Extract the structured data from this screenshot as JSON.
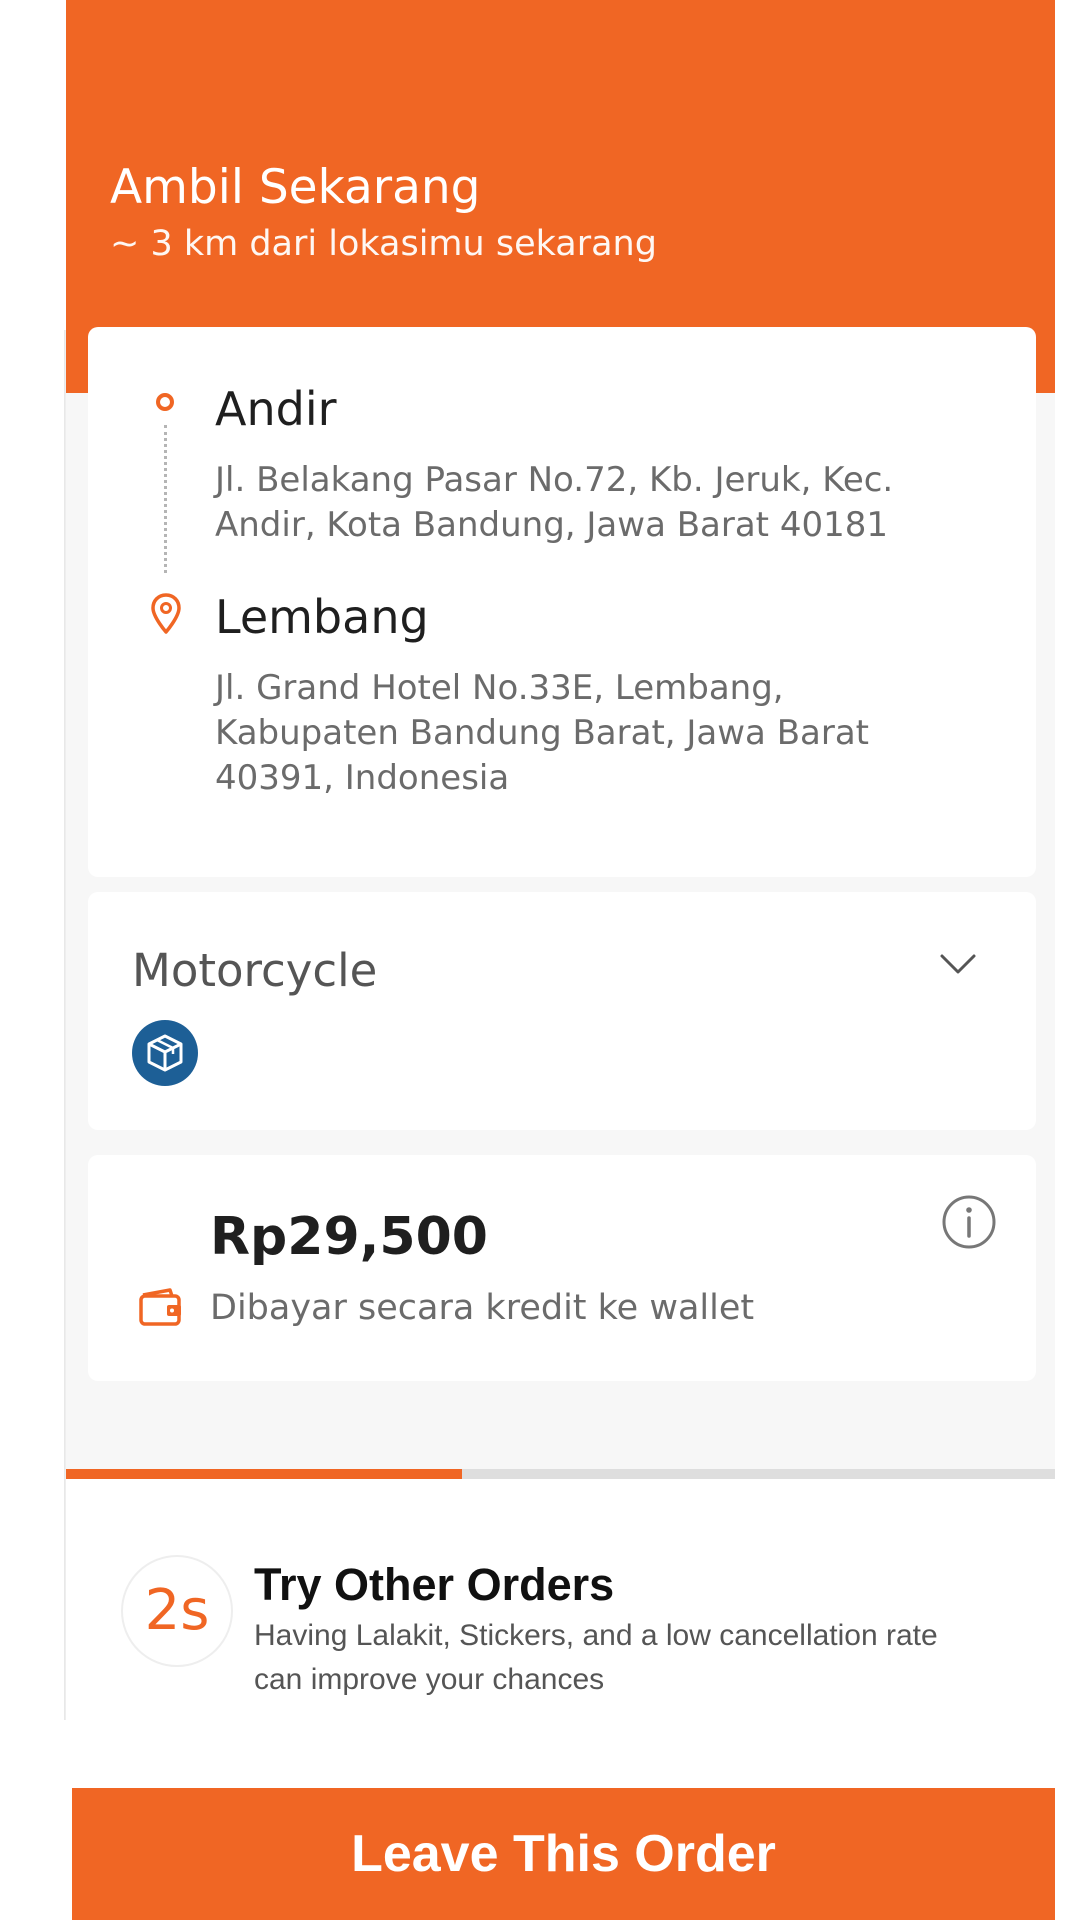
{
  "header": {
    "title": "Ambil Sekarang",
    "subtitle": "~ 3 km dari lokasimu sekarang"
  },
  "route": {
    "origin": {
      "name": "Andir",
      "address": "Jl. Belakang Pasar No.72, Kb. Jeruk, Kec. Andir, Kota Bandung, Jawa Barat 40181"
    },
    "destination": {
      "name": "Lembang",
      "address": "Jl. Grand Hotel No.33E, Lembang, Kabupaten Bandung Barat, Jawa Barat 40391, Indonesia"
    }
  },
  "vehicle": {
    "name": "Motorcycle",
    "badge_icon": "package-box-icon"
  },
  "payment": {
    "price": "Rp29,500",
    "method_text": "Dibayar secara kredit ke wallet",
    "info_icon": "info-icon",
    "wallet_icon": "wallet-icon"
  },
  "countdown": {
    "progress": 0.4
  },
  "prompt": {
    "timer": "2s",
    "title": "Try Other Orders",
    "description": "Having Lalakit, Stickers, and a low cancellation rate can improve your chances"
  },
  "actions": {
    "leave_label": "Leave This Order"
  },
  "colors": {
    "accent": "#f06624",
    "badge_blue": "#1d5f96",
    "background": "#f7f7f7"
  }
}
